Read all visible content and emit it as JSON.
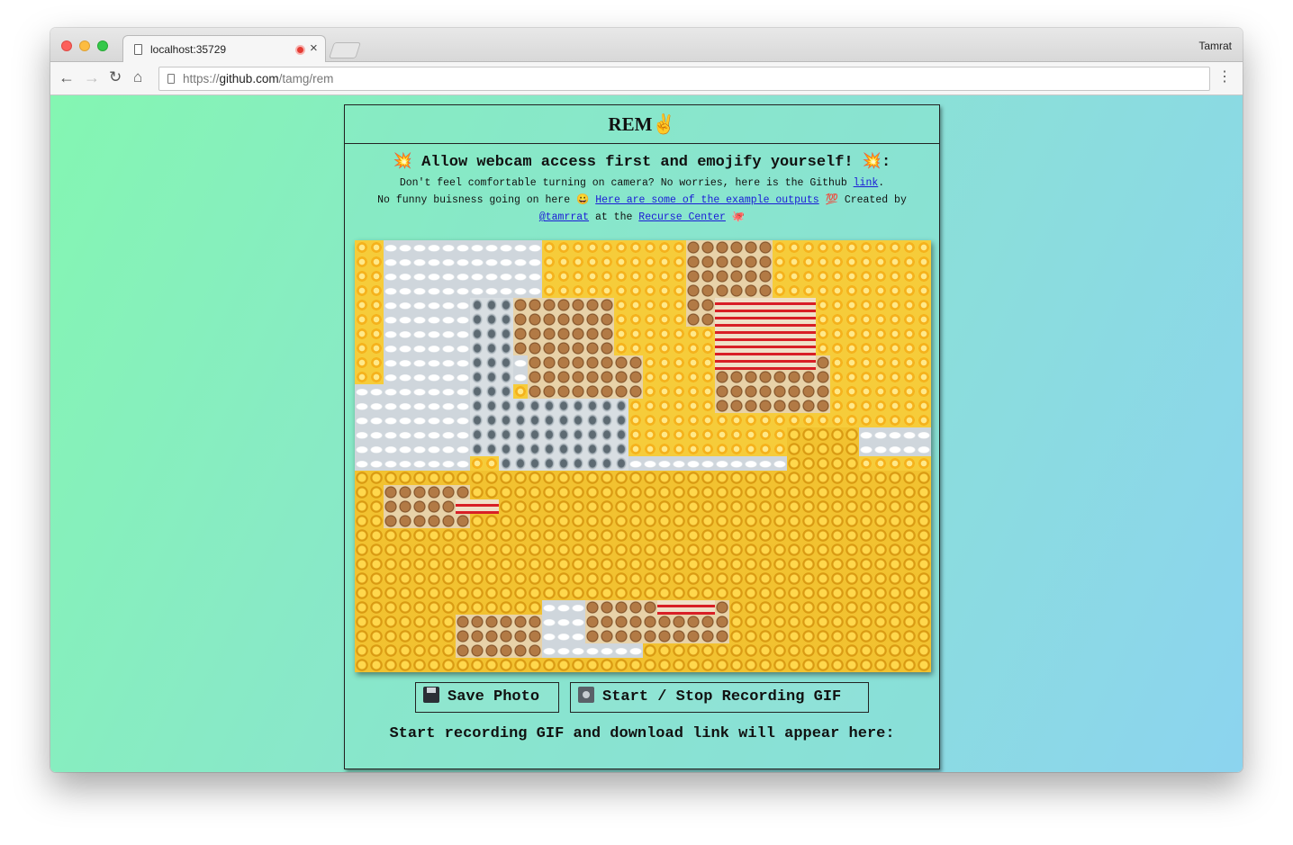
{
  "browser": {
    "tab_title": "localhost:35729",
    "profile_name": "Tamrat",
    "url_scheme": "https://",
    "url_host": "github.com",
    "url_path": "/tamg/rem",
    "icons": {
      "back": "←",
      "forward": "→",
      "reload": "↻",
      "home": "⌂",
      "menu": "⋮",
      "close": "×"
    }
  },
  "page": {
    "title": "REM",
    "title_emoji": "✌",
    "heading": "Allow webcam access first and emojify yourself!",
    "heading_emoji_left": "💥",
    "heading_emoji_right": "💥",
    "heading_colon": ":",
    "line1_text": "Don't feel comfortable turning on camera? No worries, here is the Github",
    "line1_link": "link",
    "line1_end": ".",
    "line2_text": "No funny buisness going on here",
    "line2_emoji": "😀",
    "line2_link": "Here are some of the example outputs",
    "line2_emoji2": "💯",
    "line2_end": "Created by",
    "line3_link1": "@tamrrat",
    "line3_mid": "at the",
    "line3_link2": "Recurse Center",
    "line3_emoji": "🐙",
    "save_button": "Save Photo",
    "record_button": "Start / Stop Recording GIF",
    "status_text": "Start recording GIF and download link will appear here:"
  },
  "emoji_canvas": {
    "emojis": [
      "sun",
      "cloud",
      "alien",
      "monkey",
      "laughing-face",
      "hundred-points"
    ],
    "colors": {
      "sun": "#f6cc3a",
      "cloud": "#eef2f5",
      "alien": "#5d6a72",
      "monkey": "#b27a45",
      "laugh": "#f2c230",
      "hundred": "#d81f26"
    }
  }
}
